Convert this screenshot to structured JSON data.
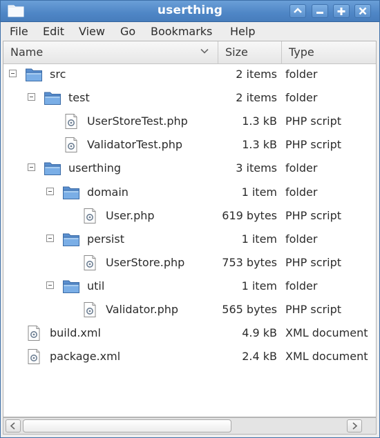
{
  "window": {
    "title": "userthing",
    "controls": {
      "shade": "shade-icon",
      "minimize": "minimize-icon",
      "maximize": "maximize-icon",
      "close": "close-icon"
    },
    "accent": "#4f86c6"
  },
  "menubar": {
    "items": [
      "File",
      "Edit",
      "View",
      "Go",
      "Bookmarks",
      "Help"
    ]
  },
  "columns": {
    "name": "Name",
    "size": "Size",
    "type": "Type",
    "sort": "chevron-down-icon"
  },
  "rows": [
    {
      "name": "src",
      "size": "2 items",
      "type": "folder",
      "icon": "folder-icon",
      "expanded": true,
      "level": 0
    },
    {
      "name": "test",
      "size": "2 items",
      "type": "folder",
      "icon": "folder-icon",
      "expanded": true,
      "level": 1
    },
    {
      "name": "UserStoreTest.php",
      "size": "1.3 kB",
      "type": "PHP script",
      "icon": "php-file-icon",
      "level": 2
    },
    {
      "name": "ValidatorTest.php",
      "size": "1.3 kB",
      "type": "PHP script",
      "icon": "php-file-icon",
      "level": 2
    },
    {
      "name": "userthing",
      "size": "3 items",
      "type": "folder",
      "icon": "folder-icon",
      "expanded": true,
      "level": 1
    },
    {
      "name": "domain",
      "size": "1 item",
      "type": "folder",
      "icon": "folder-icon",
      "expanded": true,
      "level": 2
    },
    {
      "name": "User.php",
      "size": "619 bytes",
      "type": "PHP script",
      "icon": "php-file-icon",
      "level": 3
    },
    {
      "name": "persist",
      "size": "1 item",
      "type": "folder",
      "icon": "folder-icon",
      "expanded": true,
      "level": 2
    },
    {
      "name": "UserStore.php",
      "size": "753 bytes",
      "type": "PHP script",
      "icon": "php-file-icon",
      "level": 3
    },
    {
      "name": "util",
      "size": "1 item",
      "type": "folder",
      "icon": "folder-icon",
      "expanded": true,
      "level": 2
    },
    {
      "name": "Validator.php",
      "size": "565 bytes",
      "type": "PHP script",
      "icon": "php-file-icon",
      "level": 3
    },
    {
      "name": "build.xml",
      "size": "4.9 kB",
      "type": "XML document",
      "icon": "xml-file-icon",
      "level": 0
    },
    {
      "name": "package.xml",
      "size": "2.4 kB",
      "type": "XML document",
      "icon": "xml-file-icon",
      "level": 0
    }
  ],
  "hscrollbar": {
    "left": "scroll-left-icon",
    "right": "scroll-right-icon"
  }
}
